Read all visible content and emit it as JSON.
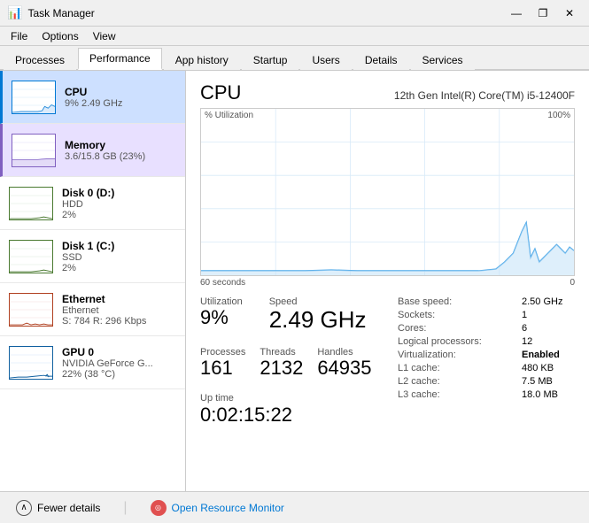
{
  "titleBar": {
    "icon": "📊",
    "title": "Task Manager",
    "minimizeBtn": "—",
    "restoreBtn": "❐",
    "closeBtn": "✕"
  },
  "menuBar": {
    "items": [
      "File",
      "Options",
      "View"
    ]
  },
  "tabs": [
    {
      "id": "processes",
      "label": "Processes"
    },
    {
      "id": "performance",
      "label": "Performance",
      "active": true
    },
    {
      "id": "app-history",
      "label": "App history"
    },
    {
      "id": "startup",
      "label": "Startup"
    },
    {
      "id": "users",
      "label": "Users"
    },
    {
      "id": "details",
      "label": "Details"
    },
    {
      "id": "services",
      "label": "Services"
    }
  ],
  "sidebar": {
    "items": [
      {
        "id": "cpu",
        "name": "CPU",
        "sub": "9% 2.49 GHz",
        "active": true,
        "thumbType": "cpu"
      },
      {
        "id": "memory",
        "name": "Memory",
        "sub": "3.6/15.8 GB (23%)",
        "active": false,
        "activeMemory": true,
        "thumbType": "mem"
      },
      {
        "id": "disk0",
        "name": "Disk 0 (D:)",
        "sub": "HDD",
        "val": "2%",
        "thumbType": "disk0"
      },
      {
        "id": "disk1",
        "name": "Disk 1 (C:)",
        "sub": "SSD",
        "val": "2%",
        "thumbType": "disk1"
      },
      {
        "id": "ethernet",
        "name": "Ethernet",
        "sub": "Ethernet",
        "val": "S: 784  R: 296 Kbps",
        "thumbType": "eth"
      },
      {
        "id": "gpu",
        "name": "GPU 0",
        "sub": "NVIDIA GeForce G...",
        "val": "22% (38 °C)",
        "thumbType": "gpu"
      }
    ]
  },
  "cpuPanel": {
    "title": "CPU",
    "model": "12th Gen Intel(R) Core(TM) i5-12400F",
    "chartLabelLeft": "% Utilization",
    "chartLabelRight": "100%",
    "chartTimeLeft": "60 seconds",
    "chartTimeRight": "0",
    "stats": {
      "utilizationLabel": "Utilization",
      "utilizationValue": "9%",
      "speedLabel": "Speed",
      "speedValue": "2.49 GHz",
      "processesLabel": "Processes",
      "processesValue": "161",
      "threadsLabel": "Threads",
      "threadsValue": "2132",
      "handlesLabel": "Handles",
      "handlesValue": "64935",
      "uptimeLabel": "Up time",
      "uptimeValue": "0:02:15:22"
    },
    "details": {
      "baseSpeedLabel": "Base speed:",
      "baseSpeedValue": "2.50 GHz",
      "socketsLabel": "Sockets:",
      "socketsValue": "1",
      "coresLabel": "Cores:",
      "coresValue": "6",
      "logicalLabel": "Logical processors:",
      "logicalValue": "12",
      "virtualizationLabel": "Virtualization:",
      "virtualizationValue": "Enabled",
      "l1Label": "L1 cache:",
      "l1Value": "480 KB",
      "l2Label": "L2 cache:",
      "l2Value": "7.5 MB",
      "l3Label": "L3 cache:",
      "l3Value": "18.0 MB"
    }
  },
  "bottomBar": {
    "fewerDetailsLabel": "Fewer details",
    "openMonitorLabel": "Open Resource Monitor"
  }
}
